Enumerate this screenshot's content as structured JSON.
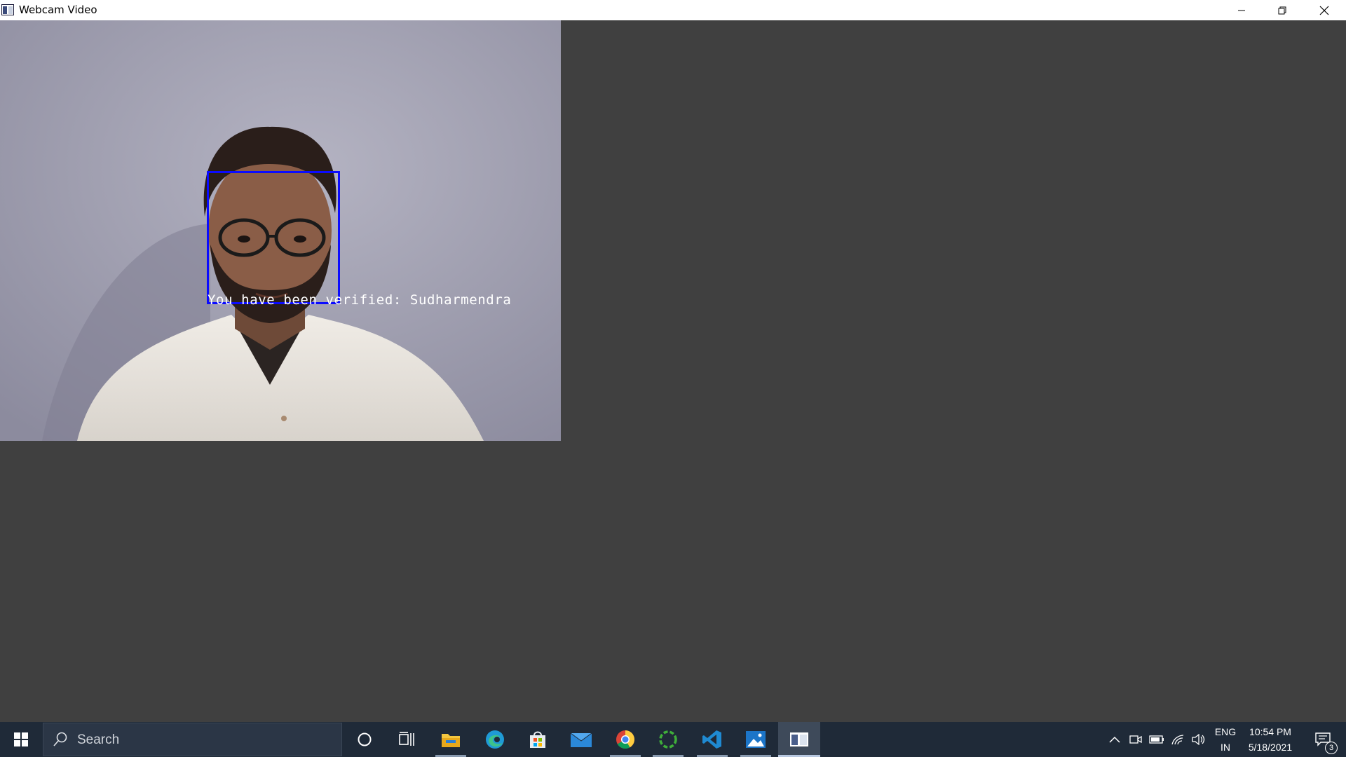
{
  "window": {
    "title": "Webcam Video",
    "controls": {
      "minimize": "minimize-icon",
      "maximize": "restore-icon",
      "close": "close-icon"
    }
  },
  "video": {
    "overlay_text": "You have been verified: Sudharmendra",
    "box_color": "#0b0bff",
    "background_color": "#404040"
  },
  "taskbar": {
    "search_placeholder": "Search",
    "apps": [
      {
        "name": "cortana-icon"
      },
      {
        "name": "task-view-icon"
      },
      {
        "name": "file-explorer-icon",
        "running": true
      },
      {
        "name": "edge-icon"
      },
      {
        "name": "microsoft-store-icon"
      },
      {
        "name": "mail-icon"
      },
      {
        "name": "chrome-icon",
        "running": true
      },
      {
        "name": "loading-app-icon",
        "running": true
      },
      {
        "name": "vscode-icon",
        "running": true
      },
      {
        "name": "photos-icon",
        "running": true
      },
      {
        "name": "webcam-app-icon",
        "active": true
      }
    ],
    "tray": {
      "language_top": "ENG",
      "language_bottom": "IN",
      "time": "10:54 PM",
      "date": "5/18/2021",
      "notification_count": "3"
    }
  }
}
